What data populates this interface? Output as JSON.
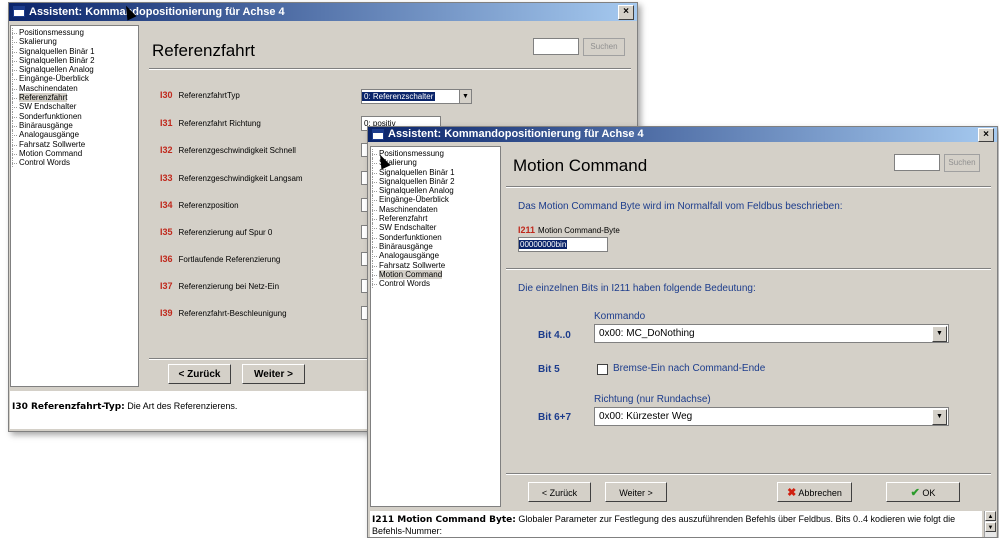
{
  "back_window": {
    "title": "Assistent: Kommandopositionierung für Achse 4",
    "close": "×",
    "tree": [
      "Positionsmessung",
      "Skalierung",
      "Signalquellen Binär 1",
      "Signalquellen Binär 2",
      "Signalquellen Analog",
      "Eingänge-Überblick",
      "Maschinendaten",
      "Referenzfahrt",
      "SW Endschalter",
      "Sonderfunktionen",
      "Binärausgänge",
      "Analogausgänge",
      "Fahrsatz Sollwerte",
      "Motion Command",
      "Control Words"
    ],
    "selected_index": 7,
    "panel_title": "Referenzfahrt",
    "search_button": "Suchen",
    "params": [
      {
        "num": "I30",
        "label": "ReferenzfahrtTyp"
      },
      {
        "num": "I31",
        "label": "Referenzfahrt Richtung"
      },
      {
        "num": "I32",
        "label": "Referenzgeschwindigkeit Schnell"
      },
      {
        "num": "I33",
        "label": "Referenzgeschwindigkeit Langsam"
      },
      {
        "num": "I34",
        "label": "Referenzposition"
      },
      {
        "num": "I35",
        "label": "Referenzierung auf Spur 0"
      },
      {
        "num": "I36",
        "label": "Fortlaufende Referenzierung"
      },
      {
        "num": "I37",
        "label": "Referenzierung bei Netz-Ein"
      },
      {
        "num": "I39",
        "label": "Referenzfahrt-Beschleunigung"
      }
    ],
    "combo_i30": "0: Referenzschalter",
    "combo_i31": "0: positiv",
    "back_button": "< Zurück",
    "next_button": "Weiter >",
    "help_bold": "I30 Referenzfahrt-Typ:",
    "help_text": " Die Art des Referenzierens."
  },
  "front_window": {
    "title": "Assistent: Kommandopositionierung für Achse 4",
    "close": "×",
    "tree": [
      "Positionsmessung",
      "Skalierung",
      "Signalquellen Binär 1",
      "Signalquellen Binär 2",
      "Signalquellen Analog",
      "Eingänge-Überblick",
      "Maschinendaten",
      "Referenzfahrt",
      "SW Endschalter",
      "Sonderfunktionen",
      "Binärausgänge",
      "Analogausgänge",
      "Fahrsatz Sollwerte",
      "Motion Command",
      "Control Words"
    ],
    "selected_index": 13,
    "panel_title": "Motion Command",
    "search_button": "Suchen",
    "intro": "Das Motion Command Byte wird im Normalfall vom Feldbus beschrieben:",
    "i211_num": "I211",
    "i211_label": "Motion Command-Byte",
    "i211_value": "00000000bin",
    "bits_intro": "Die einzelnen Bits in I211 haben folgende Bedeutung:",
    "kommando_label": "Kommando",
    "bit40_label": "Bit 4..0",
    "bit40_value": "0x00: MC_DoNothing",
    "bit5_label": "Bit 5",
    "bit5_text": "Bremse-Ein nach Command-Ende",
    "richtung_label": "Richtung (nur Rundachse)",
    "bit67_label": "Bit 6+7",
    "bit67_value": "0x00: Kürzester Weg",
    "back_button": "< Zurück",
    "next_button": "Weiter >",
    "cancel_button": "Abbrechen",
    "ok_button": "OK",
    "help_bold": "I211  Motion Command Byte:",
    "help_text": " Globaler Parameter zur Festlegung des auszuführenden Befehls über Feldbus. Bits 0..4 kodieren wie folgt die Befehls-Nummer:"
  },
  "colors": {
    "param_red": "#c0281c",
    "label_blue": "#1c3c8c",
    "titlebar": "#0a246a"
  }
}
